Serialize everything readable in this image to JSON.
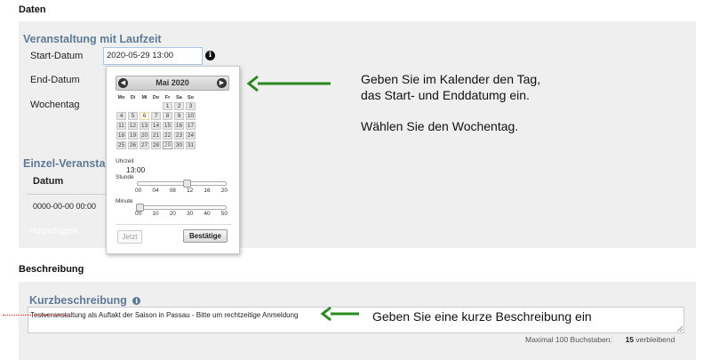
{
  "sections": {
    "daten": "Daten",
    "beschreibung": "Beschreibung"
  },
  "laufzeit": {
    "legend": "Veranstaltung mit Laufzeit",
    "start_label": "Start-Datum",
    "start_value": "2020-05-29 13:00",
    "end_label": "End-Datum",
    "weekday_label": "Wochentag"
  },
  "einzel": {
    "legend": "Einzel-Veranstaltu",
    "column_datum": "Datum",
    "date_value": "0000-00-00 00:00",
    "add_label": "Hinzufügen"
  },
  "datepicker": {
    "month_title": "Mai 2020",
    "prev_icon": "circle-triangle-left",
    "next_icon": "circle-triangle-right",
    "weekdays": [
      "Mo",
      "Di",
      "Mi",
      "Do",
      "Fr",
      "Sa",
      "So"
    ],
    "weeks": [
      [
        "",
        "",
        "",
        "",
        "1",
        "2",
        "3"
      ],
      [
        "4",
        "5",
        "6",
        "7",
        "8",
        "9",
        "10"
      ],
      [
        "11",
        "12",
        "13",
        "14",
        "15",
        "16",
        "17"
      ],
      [
        "18",
        "19",
        "20",
        "21",
        "22",
        "23",
        "24"
      ],
      [
        "25",
        "26",
        "27",
        "28",
        "29",
        "30",
        "31"
      ]
    ],
    "today_day": "6",
    "selected_day": "29",
    "time_label": "Uhrzeit",
    "time_value": "13:00",
    "hour_label": "Stunde",
    "hour_ticks": [
      "00",
      "04",
      "08",
      "12",
      "16",
      "20"
    ],
    "hour_value": 13,
    "minute_label": "Minute",
    "minute_ticks": [
      "00",
      "10",
      "20",
      "30",
      "40",
      "50"
    ],
    "minute_value": 0,
    "now_button": "Jetzt",
    "done_button": "Bestätige"
  },
  "kurz": {
    "legend": "Kurzbeschreibung",
    "value": "Testveranstaltung als Auftakt der Saison in Passau - Bitte um rechtzeitige Anmeldung",
    "counter_label": "Maximal 100 Buchstaben:",
    "counter_value": "15",
    "counter_suffix": "verbleibend"
  },
  "annotations": {
    "calendar_line1": "Geben Sie im Kalender den Tag,",
    "calendar_line2": "das Start- und Enddatumg ein.",
    "weekday_line": "Wählen Sie den Wochentag.",
    "description": "Geben Sie eine kurze Beschreibung ein",
    "arrow_color": "#2a8a1f"
  },
  "colors": {
    "panel_bg": "#efefef",
    "legend": "#5f7a96",
    "input_border": "#aac4e0"
  }
}
